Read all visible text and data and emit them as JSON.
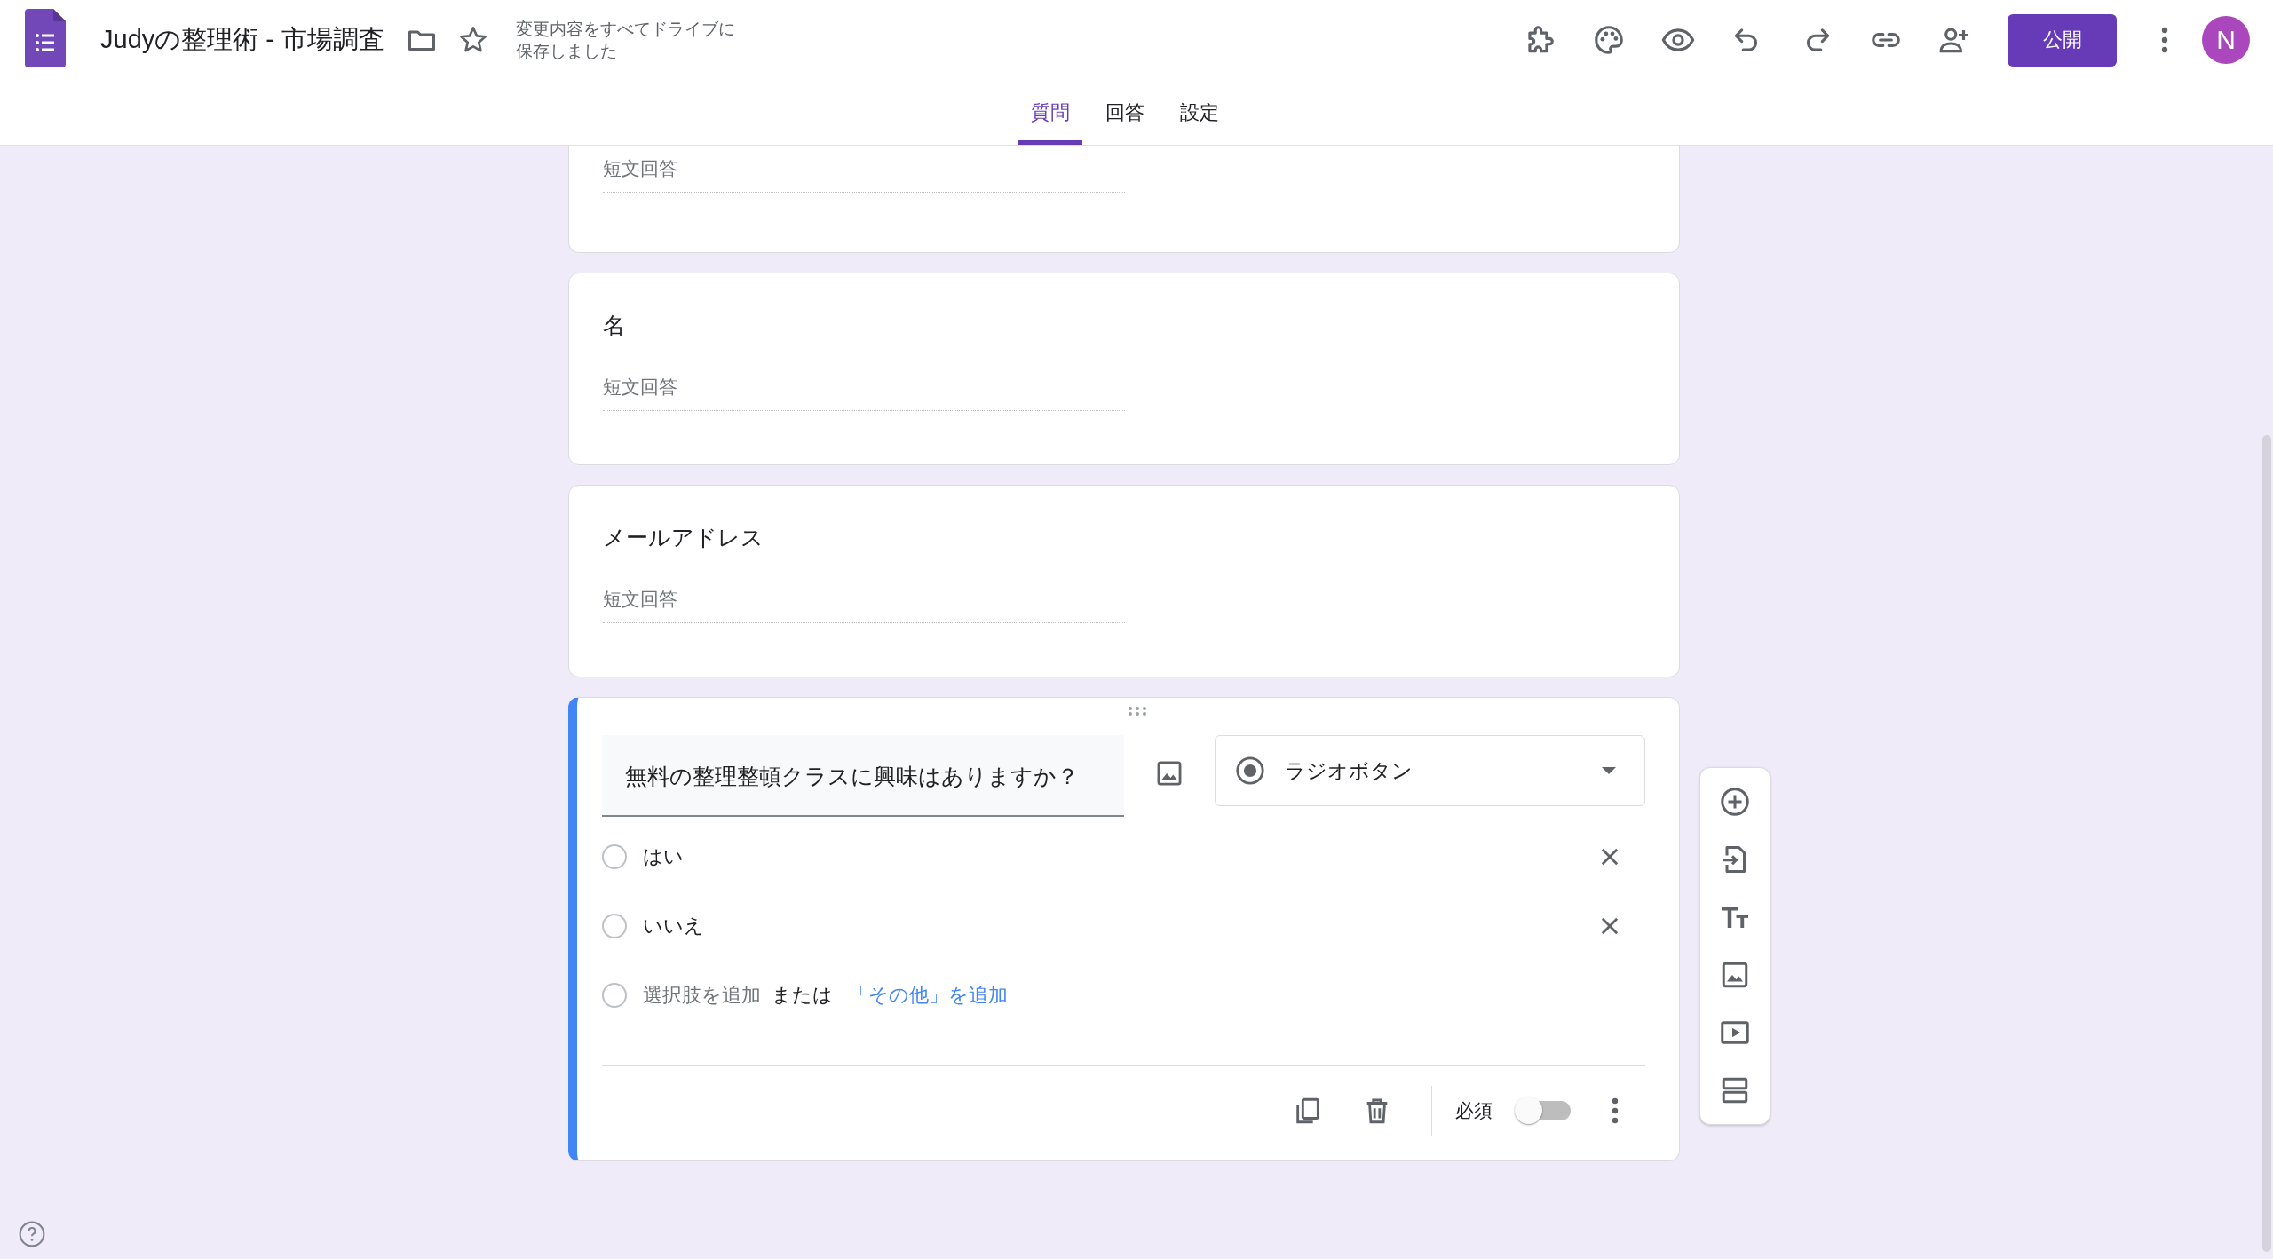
{
  "header": {
    "title": "Judyの整理術 - 市場調査",
    "save_status": "変更内容をすべてドライブに保存しました",
    "publish_button": "公開",
    "avatar": "N"
  },
  "tabs": [
    {
      "label": "質問",
      "selected": true
    },
    {
      "label": "回答",
      "selected": false
    },
    {
      "label": "設定",
      "selected": false
    }
  ],
  "questions": [
    {
      "kind": "short_answer",
      "placeholder": "短文回答"
    },
    {
      "kind": "short_answer",
      "title": "名",
      "placeholder": "短文回答"
    },
    {
      "kind": "short_answer",
      "title": "メールアドレス",
      "placeholder": "短文回答"
    }
  ],
  "active_question": {
    "title": "無料の整理整頓クラスに興味はありますか？",
    "type": "ラジオボタン",
    "options": [
      {
        "label": "はい",
        "selected": false
      },
      {
        "label": "いいえ",
        "selected": false
      }
    ],
    "add_option": "選択肢を追加",
    "add_option_selected": false,
    "or": "または",
    "add_other": "「その他」を追加",
    "required_label": "必須",
    "required": false
  }
}
